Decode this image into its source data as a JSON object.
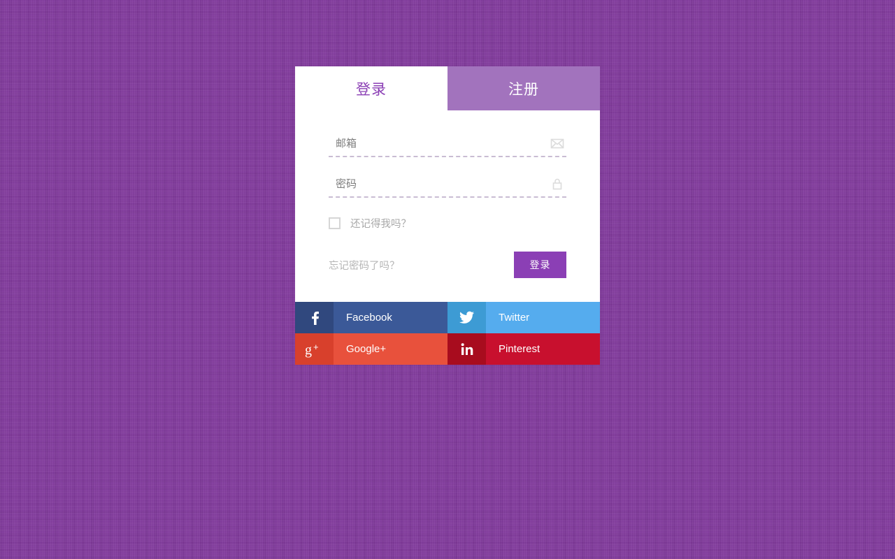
{
  "theme": {
    "background_color": "#833a9e",
    "accent_color": "#8b3fb5",
    "tab_inactive_color": "#a273bd"
  },
  "tabs": [
    {
      "label": "登录",
      "state": "active"
    },
    {
      "label": "注册",
      "state": "inactive"
    }
  ],
  "form": {
    "email": {
      "value": "",
      "placeholder": "邮箱",
      "icon": "envelope-icon"
    },
    "password": {
      "value": "",
      "placeholder": "密码",
      "icon": "lock-icon"
    },
    "remember": {
      "label": "还记得我吗？",
      "checked": false
    },
    "forgot_label": "忘记密码了吗？",
    "submit_label": "登录"
  },
  "social": [
    {
      "name": "facebook",
      "label": "Facebook",
      "icon": "facebook-icon",
      "icon_bg": "#30487e",
      "label_bg": "#3b5998"
    },
    {
      "name": "twitter",
      "label": "Twitter",
      "icon": "twitter-icon",
      "icon_bg": "#3d9bd4",
      "label_bg": "#55acee"
    },
    {
      "name": "googleplus",
      "label": "Google+",
      "icon": "google-plus-icon",
      "icon_bg": "#d8402c",
      "label_bg": "#e8513c"
    },
    {
      "name": "pinterest",
      "label": "Pinterest",
      "icon": "linkedin-icon",
      "icon_bg": "#a80c1e",
      "label_bg": "#c8102e"
    }
  ]
}
